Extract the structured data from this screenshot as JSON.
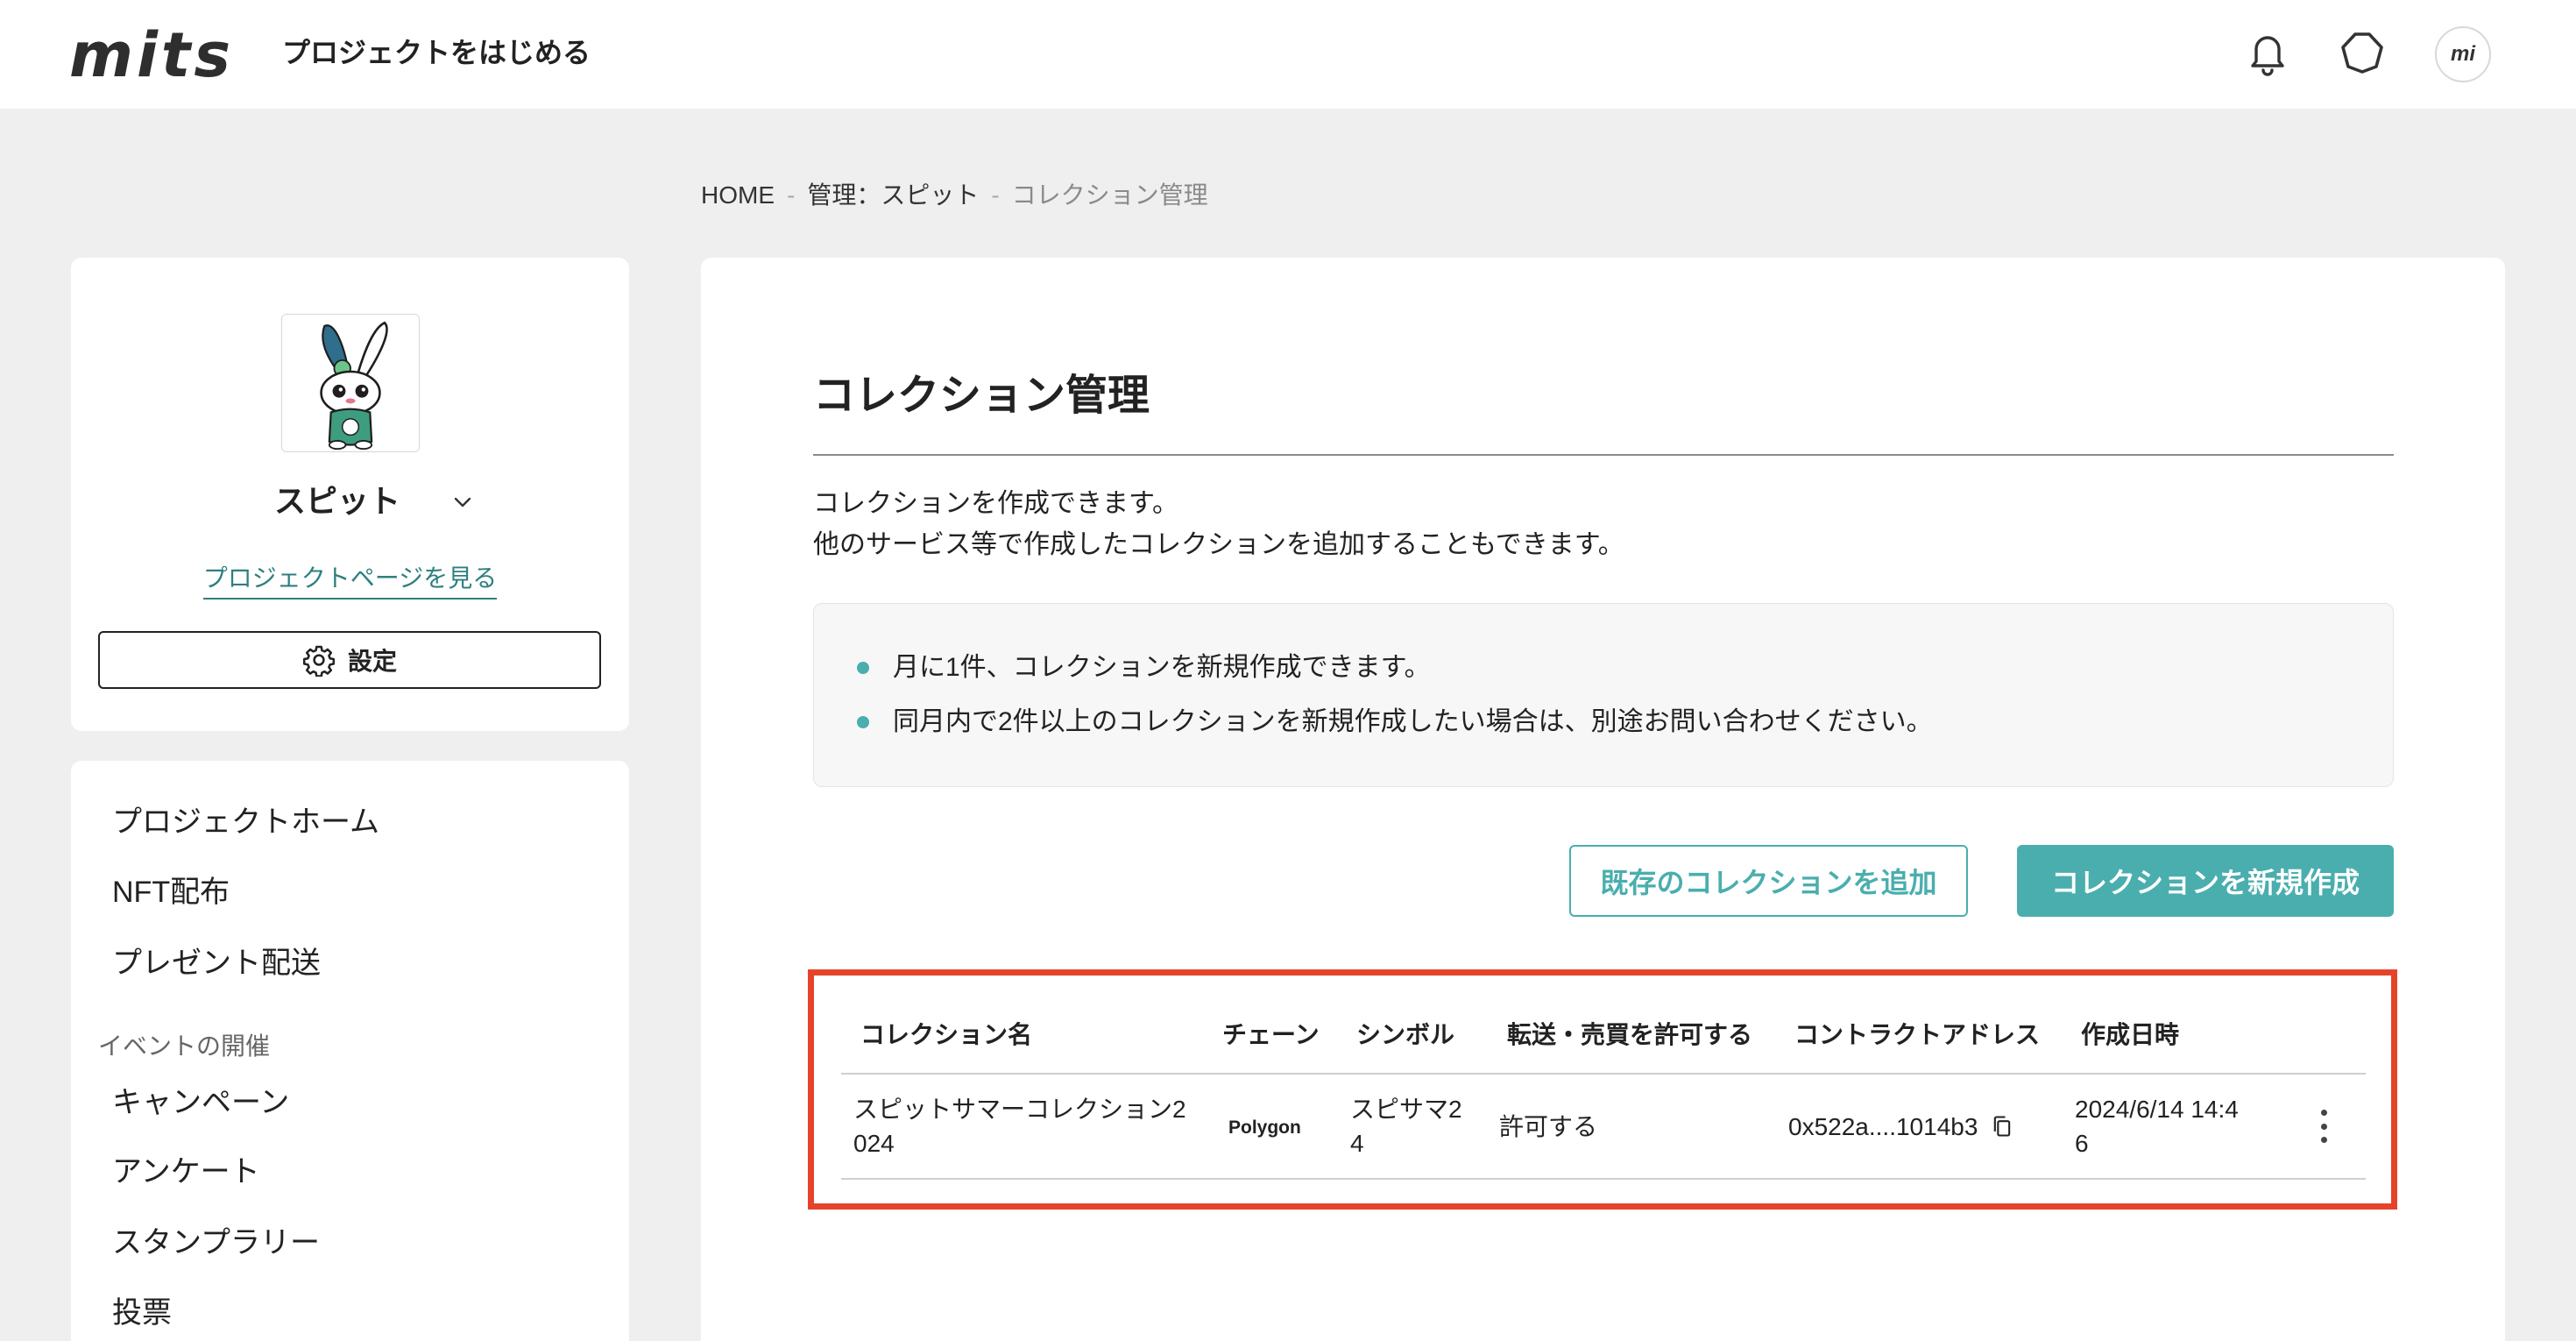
{
  "header": {
    "logo": "mits",
    "title": "プロジェクトをはじめる",
    "avatar_logo": "mi",
    "icons": [
      "bell-icon",
      "hexagon-icon"
    ]
  },
  "breadcrumb": {
    "items": [
      "HOME",
      "管理：スピット",
      "コレクション管理"
    ],
    "separator": "-"
  },
  "project": {
    "name": "スピット",
    "view_page_link": "プロジェクトページを見る",
    "settings_label": "設定"
  },
  "nav": {
    "items": [
      "プロジェクトホーム",
      "NFT配布",
      "プレゼント配送"
    ],
    "events_section": {
      "title": "イベントの開催",
      "items": [
        "キャンペーン",
        "アンケート",
        "スタンプラリー",
        "投票"
      ]
    }
  },
  "main": {
    "title": "コレクション管理",
    "description": [
      "コレクションを作成できます。",
      "他のサービス等で作成したコレクションを追加することもできます。"
    ],
    "notes": [
      "月に1件、コレクションを新規作成できます。",
      "同月内で2件以上のコレクションを新規作成したい場合は、別途お問い合わせください。"
    ],
    "buttons": {
      "add_existing": "既存のコレクションを追加",
      "create_new": "コレクションを新規作成"
    }
  },
  "table": {
    "columns": [
      "コレクション名",
      "チェーン",
      "シンボル",
      "転送・売買を許可する",
      "コントラクトアドレス",
      "作成日時"
    ],
    "rows": [
      {
        "name": "スピットサマーコレクション2024",
        "chain": "Polygon",
        "symbol": "スピサマ24",
        "transfer": "許可する",
        "contract_address": "0x522a....1014b3",
        "created_at": "2024/6/14 14:46"
      }
    ]
  },
  "colors": {
    "accent": "#4aaeae",
    "link": "#2f7f7f",
    "highlight": "#e5442b",
    "background": "#efefef"
  }
}
